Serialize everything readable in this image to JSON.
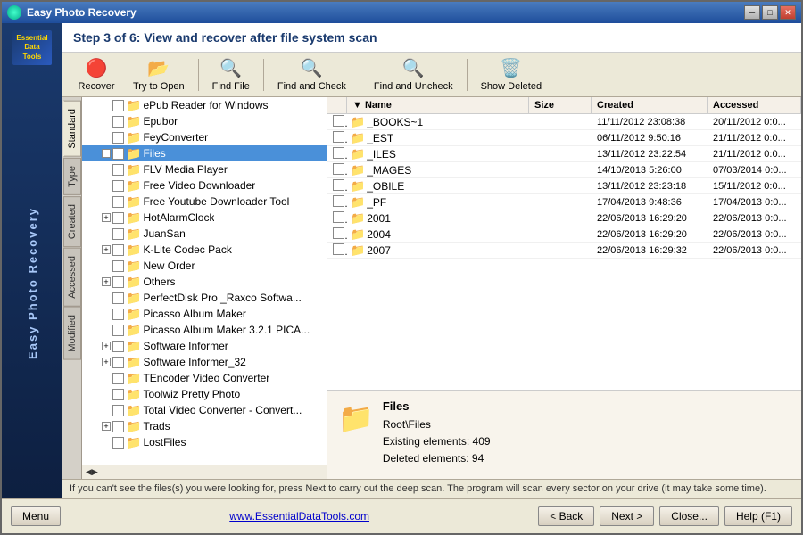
{
  "window": {
    "title": "Easy Photo Recovery",
    "step_header": "Step 3 of 6: View and recover after file system scan"
  },
  "toolbar": {
    "recover_label": "Recover",
    "try_open_label": "Try to Open",
    "find_file_label": "Find File",
    "find_check_label": "Find and Check",
    "find_uncheck_label": "Find and Uncheck",
    "show_deleted_label": "Show Deleted"
  },
  "tabs": {
    "items": [
      "Standard",
      "Type",
      "Created",
      "Accessed",
      "Modified"
    ]
  },
  "tree": {
    "items": [
      {
        "label": "ePub Reader for Windows",
        "indent": 1,
        "has_expand": false,
        "selected": false
      },
      {
        "label": "Epubor",
        "indent": 1,
        "has_expand": false,
        "selected": false
      },
      {
        "label": "FeyConverter",
        "indent": 1,
        "has_expand": false,
        "selected": false
      },
      {
        "label": "Files",
        "indent": 1,
        "has_expand": true,
        "selected": true
      },
      {
        "label": "FLV Media Player",
        "indent": 1,
        "has_expand": false,
        "selected": false
      },
      {
        "label": "Free Video Downloader",
        "indent": 1,
        "has_expand": false,
        "selected": false
      },
      {
        "label": "Free Youtube Downloader Tool",
        "indent": 1,
        "has_expand": false,
        "selected": false
      },
      {
        "label": "HotAlarmClock",
        "indent": 1,
        "has_expand": true,
        "selected": false
      },
      {
        "label": "JuanSan",
        "indent": 1,
        "has_expand": false,
        "selected": false
      },
      {
        "label": "K-Lite Codec Pack",
        "indent": 1,
        "has_expand": true,
        "selected": false
      },
      {
        "label": "New Order",
        "indent": 1,
        "has_expand": false,
        "selected": false
      },
      {
        "label": "Others",
        "indent": 1,
        "has_expand": true,
        "selected": false
      },
      {
        "label": "PerfectDisk Pro _Raxco Softwa...",
        "indent": 1,
        "has_expand": false,
        "selected": false
      },
      {
        "label": "Picasso Album Maker",
        "indent": 1,
        "has_expand": false,
        "selected": false
      },
      {
        "label": "Picasso Album Maker 3.2.1 PICA...",
        "indent": 1,
        "has_expand": false,
        "selected": false
      },
      {
        "label": "Software Informer",
        "indent": 1,
        "has_expand": true,
        "selected": false
      },
      {
        "label": "Software Informer_32",
        "indent": 1,
        "has_expand": true,
        "selected": false
      },
      {
        "label": "TEncoder Video Converter",
        "indent": 1,
        "has_expand": false,
        "selected": false
      },
      {
        "label": "Toolwiz Pretty Photo",
        "indent": 1,
        "has_expand": false,
        "selected": false
      },
      {
        "label": "Total Video Converter - Convert...",
        "indent": 1,
        "has_expand": false,
        "selected": false
      },
      {
        "label": "Trads",
        "indent": 1,
        "has_expand": true,
        "selected": false
      },
      {
        "label": "LostFiles",
        "indent": 1,
        "has_expand": false,
        "selected": false
      }
    ]
  },
  "file_list": {
    "headers": [
      "",
      "Name",
      "Size",
      "Created",
      "Accessed"
    ],
    "rows": [
      {
        "name": "_BOOKS~1",
        "size": "",
        "created": "11/11/2012 23:08:38",
        "accessed": "20/11/2012 0:0..."
      },
      {
        "name": "_EST",
        "size": "",
        "created": "06/11/2012 9:50:16",
        "accessed": "21/11/2012 0:0..."
      },
      {
        "name": "_ILES",
        "size": "",
        "created": "13/11/2012 23:22:54",
        "accessed": "21/11/2012 0:0..."
      },
      {
        "name": "_MAGES",
        "size": "",
        "created": "14/10/2013 5:26:00",
        "accessed": "07/03/2014 0:0..."
      },
      {
        "name": "_OBILE",
        "size": "",
        "created": "13/11/2012 23:23:18",
        "accessed": "15/11/2012 0:0..."
      },
      {
        "name": "_PF",
        "size": "",
        "created": "17/04/2013 9:48:36",
        "accessed": "17/04/2013 0:0..."
      },
      {
        "name": "2001",
        "size": "",
        "created": "22/06/2013 16:29:20",
        "accessed": "22/06/2013 0:0..."
      },
      {
        "name": "2004",
        "size": "",
        "created": "22/06/2013 16:29:20",
        "accessed": "22/06/2013 0:0..."
      },
      {
        "name": "2007",
        "size": "",
        "created": "22/06/2013 16:29:32",
        "accessed": "22/06/2013 0:0..."
      }
    ]
  },
  "info_panel": {
    "title": "Files",
    "path": "Root\\Files",
    "existing": "Existing elements: 409",
    "deleted": "Deleted elements: 94"
  },
  "status_bar": {
    "message": "If you can't see the files(s) you were looking for, press Next to carry out the deep scan. The program will scan every sector on your drive (it may take some time)."
  },
  "bottom": {
    "menu_label": "Menu",
    "website": "www.EssentialDataTools.com",
    "back_label": "< Back",
    "next_label": "Next >",
    "close_label": "Close...",
    "help_label": "Help (F1)"
  }
}
